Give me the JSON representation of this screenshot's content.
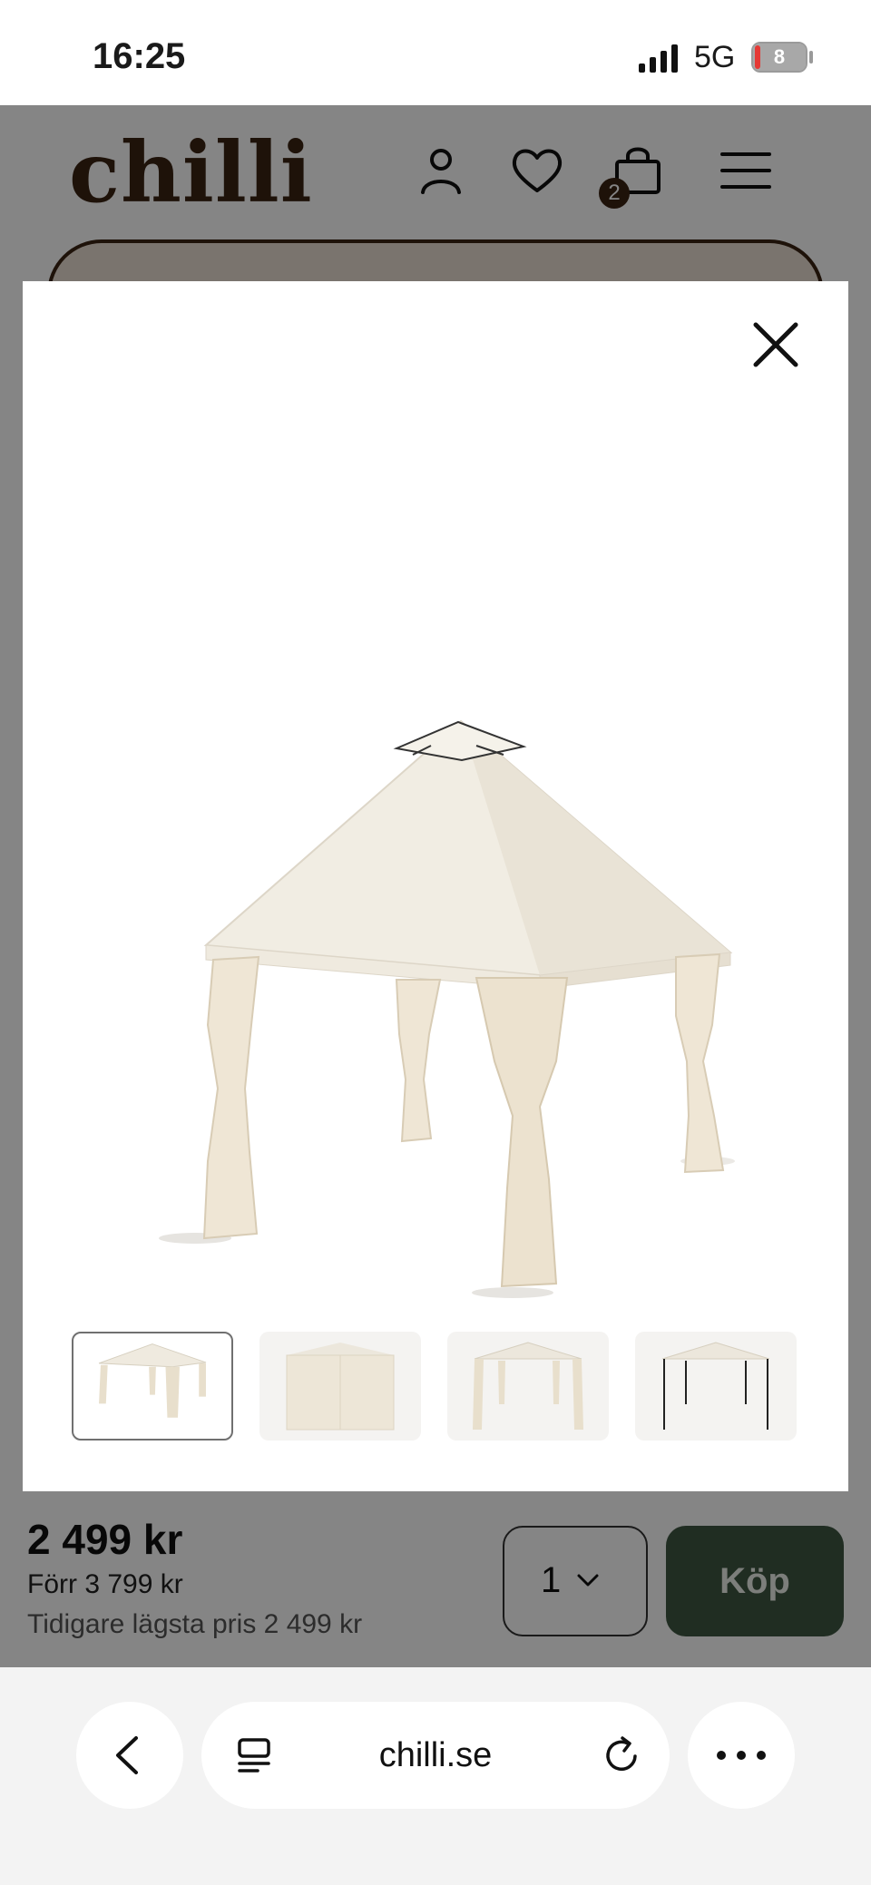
{
  "status_bar": {
    "time": "16:25",
    "network": "5G",
    "battery": "8"
  },
  "header": {
    "logo": "chilli",
    "cart_count": "2"
  },
  "modal": {
    "thumbnails": [
      "gazebo-curtains-tied",
      "gazebo-curtains-closed",
      "gazebo-curtains-tied-side",
      "gazebo-frame-only"
    ],
    "active_thumbnail": 0
  },
  "buy_bar": {
    "price": "2 499 kr",
    "previous_price": "Förr 3 799 kr",
    "lowest_price": "Tidigare lägsta pris 2 499 kr",
    "quantity": "1",
    "buy_label": "Köp"
  },
  "browser": {
    "url": "chilli.se"
  },
  "colors": {
    "brand_brown": "#3b2313",
    "buy_green": "#3f5641"
  }
}
